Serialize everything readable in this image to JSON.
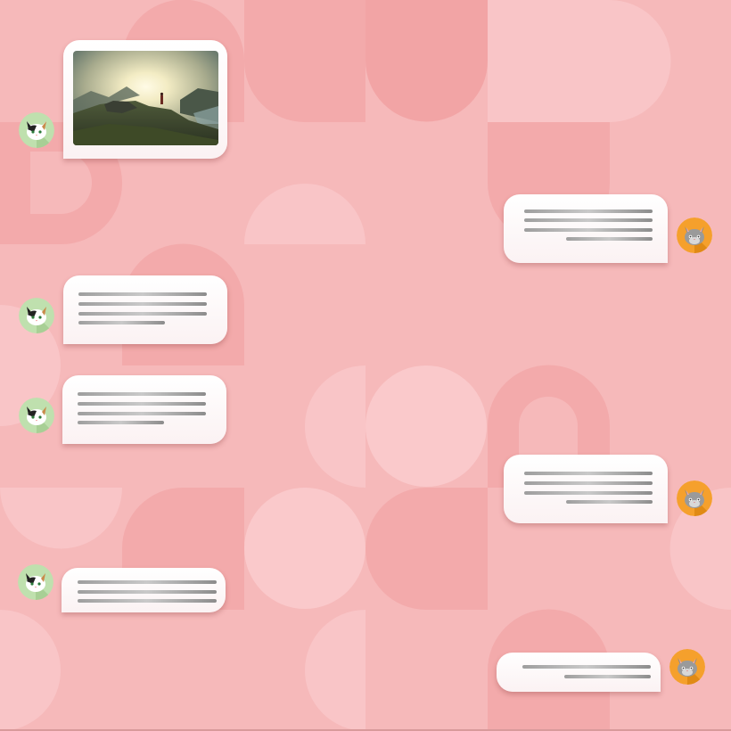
{
  "app": {
    "background_color": "#f6b9ba",
    "pattern_colors": [
      "#f3aaab",
      "#f9c5c7",
      "#f7b2b3"
    ]
  },
  "contacts": {
    "left": {
      "name": "",
      "avatar_icon": "calico-cat-icon",
      "avatar_bg": "#bfe0ae"
    },
    "right": {
      "name": "",
      "avatar_icon": "grey-cat-icon",
      "avatar_bg": "#f5a02c"
    }
  },
  "messages": [
    {
      "sender": "left",
      "kind": "image",
      "image_icon": "mountain-landscape-photo"
    },
    {
      "sender": "right",
      "kind": "redacted-text",
      "line_count": 4
    },
    {
      "sender": "left",
      "kind": "redacted-text",
      "line_count": 4
    },
    {
      "sender": "left",
      "kind": "redacted-text",
      "line_count": 4
    },
    {
      "sender": "right",
      "kind": "redacted-text",
      "line_count": 4
    },
    {
      "sender": "left",
      "kind": "redacted-text",
      "line_count": 3
    },
    {
      "sender": "right",
      "kind": "redacted-text",
      "line_count": 2
    }
  ]
}
